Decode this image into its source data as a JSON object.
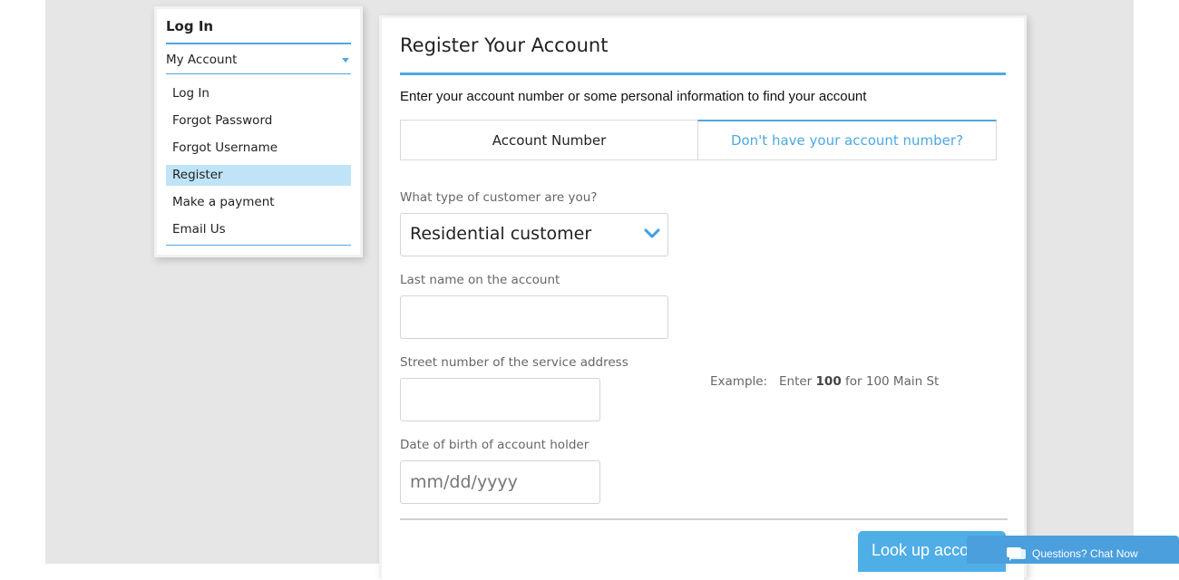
{
  "sidebar": {
    "title": "Log In",
    "section_label": "My Account",
    "items": [
      {
        "label": "Log In",
        "active": false
      },
      {
        "label": "Forgot Password",
        "active": false
      },
      {
        "label": "Forgot Username",
        "active": false
      },
      {
        "label": "Register",
        "active": true
      },
      {
        "label": "Make a payment",
        "active": false
      },
      {
        "label": "Email Us",
        "active": false
      }
    ]
  },
  "main": {
    "title": "Register Your Account",
    "intro": "Enter your account number or some personal information to find your account",
    "tabs": [
      {
        "label": "Account Number",
        "active": false
      },
      {
        "label": "Don't have your account number?",
        "active": true
      }
    ],
    "form": {
      "customer_type": {
        "label": "What type of customer are you?",
        "value": "Residential customer"
      },
      "last_name": {
        "label": "Last name on the account",
        "value": "",
        "placeholder": ""
      },
      "street_number": {
        "label": "Street number of the service address",
        "value": "",
        "placeholder": ""
      },
      "street_example": {
        "prefix": "Example:   Enter ",
        "bold": "100",
        "suffix": " for 100 Main St"
      },
      "dob": {
        "label": "Date of birth of account holder",
        "value": "",
        "placeholder": "mm/dd/yyyy"
      }
    },
    "lookup_button": "Look up account"
  },
  "chat": {
    "label": "Questions? Chat Now"
  },
  "colors": {
    "accent": "#4ea8e0",
    "highlight": "#bfe4f7",
    "button": "#4faee6",
    "chat": "#4a9fdc"
  }
}
